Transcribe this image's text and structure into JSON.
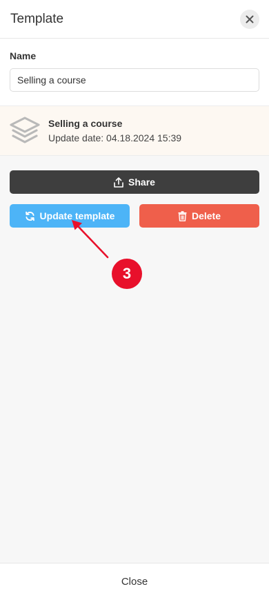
{
  "dialog": {
    "title": "Template",
    "close_icon": "close-icon"
  },
  "name_field": {
    "label": "Name",
    "value": "Selling a course"
  },
  "template_info": {
    "icon": "layers-icon",
    "title": "Selling a course",
    "update_date": "Update date: 04.18.2024 15:39"
  },
  "actions": {
    "share_label": "Share",
    "update_label": "Update template",
    "delete_label": "Delete"
  },
  "annotation": {
    "step_number": "3"
  },
  "footer": {
    "close_label": "Close"
  },
  "colors": {
    "share": "#3e3e3e",
    "update": "#4db4f7",
    "delete": "#ef5f4b",
    "annotation": "#e8102b",
    "info_card_bg": "#fdf8f2"
  }
}
